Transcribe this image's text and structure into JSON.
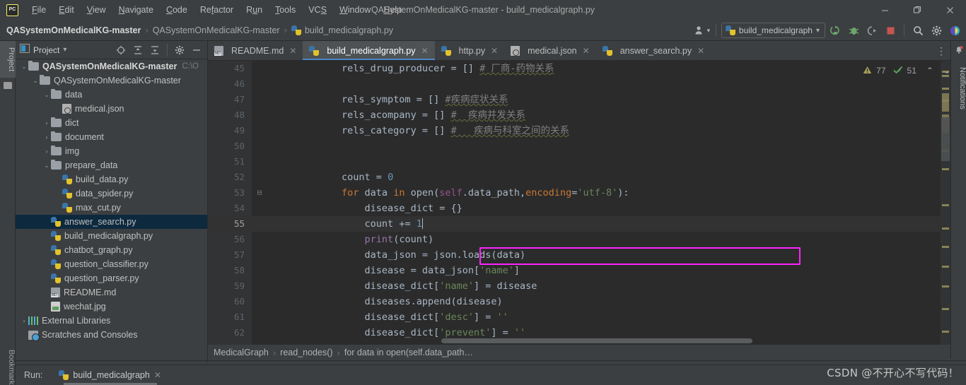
{
  "window": {
    "title": "QASystemOnMedicalKG-master - build_medicalgraph.py",
    "logo": "PC",
    "minimize": "—",
    "maximize": "❐",
    "close": "✕"
  },
  "menu": {
    "items": [
      "File",
      "Edit",
      "View",
      "Navigate",
      "Code",
      "Refactor",
      "Run",
      "Tools",
      "VCS",
      "Window",
      "Help"
    ]
  },
  "navbar": {
    "crumbs": [
      "QASystemOnMedicalKG-master",
      "QASystemOnMedicalKG-master",
      "build_medicalgraph.py"
    ],
    "separator": "›",
    "run_config": "build_medicalgraph",
    "dropdown_caret": "▾",
    "icons": {
      "user": "user-icon",
      "run": "run-icon",
      "debug": "debug-icon",
      "coverage": "coverage-icon",
      "stop": "stop-icon",
      "search": "search-icon",
      "settings": "gear-icon",
      "updates": "updates-icon"
    }
  },
  "left_strip": {
    "project_tab": "Project",
    "bookmarks_tab": "Bookmarks"
  },
  "right_strip": {
    "notifications_tab": "Notifications"
  },
  "project_panel": {
    "title": "Project",
    "caret": "▾",
    "tree": [
      {
        "indent": 0,
        "arrow": "⌄",
        "icon": "folder",
        "label": "QASystemOnMedicalKG-master",
        "bold": true,
        "path": "C:\\O",
        "selected": false
      },
      {
        "indent": 1,
        "arrow": "⌄",
        "icon": "folder",
        "label": "QASystemOnMedicalKG-master",
        "bold": false,
        "path": "",
        "selected": false
      },
      {
        "indent": 2,
        "arrow": "⌄",
        "icon": "folder",
        "label": "data",
        "bold": false,
        "path": "",
        "selected": false
      },
      {
        "indent": 3,
        "arrow": "",
        "icon": "json",
        "label": "medical.json",
        "bold": false,
        "path": "",
        "selected": false
      },
      {
        "indent": 2,
        "arrow": "›",
        "icon": "folder",
        "label": "dict",
        "bold": false,
        "path": "",
        "selected": false
      },
      {
        "indent": 2,
        "arrow": "›",
        "icon": "folder",
        "label": "document",
        "bold": false,
        "path": "",
        "selected": false
      },
      {
        "indent": 2,
        "arrow": "›",
        "icon": "folder",
        "label": "img",
        "bold": false,
        "path": "",
        "selected": false
      },
      {
        "indent": 2,
        "arrow": "⌄",
        "icon": "folder",
        "label": "prepare_data",
        "bold": false,
        "path": "",
        "selected": false
      },
      {
        "indent": 3,
        "arrow": "",
        "icon": "py",
        "label": "build_data.py",
        "bold": false,
        "path": "",
        "selected": false
      },
      {
        "indent": 3,
        "arrow": "",
        "icon": "py",
        "label": "data_spider.py",
        "bold": false,
        "path": "",
        "selected": false
      },
      {
        "indent": 3,
        "arrow": "",
        "icon": "py",
        "label": "max_cut.py",
        "bold": false,
        "path": "",
        "selected": false
      },
      {
        "indent": 2,
        "arrow": "",
        "icon": "py",
        "label": "answer_search.py",
        "bold": false,
        "path": "",
        "selected": true
      },
      {
        "indent": 2,
        "arrow": "",
        "icon": "py",
        "label": "build_medicalgraph.py",
        "bold": false,
        "path": "",
        "selected": false
      },
      {
        "indent": 2,
        "arrow": "",
        "icon": "py",
        "label": "chatbot_graph.py",
        "bold": false,
        "path": "",
        "selected": false
      },
      {
        "indent": 2,
        "arrow": "",
        "icon": "py",
        "label": "question_classifier.py",
        "bold": false,
        "path": "",
        "selected": false
      },
      {
        "indent": 2,
        "arrow": "",
        "icon": "py",
        "label": "question_parser.py",
        "bold": false,
        "path": "",
        "selected": false
      },
      {
        "indent": 2,
        "arrow": "",
        "icon": "md",
        "label": "README.md",
        "bold": false,
        "path": "",
        "selected": false
      },
      {
        "indent": 2,
        "arrow": "",
        "icon": "jpg",
        "label": "wechat.jpg",
        "bold": false,
        "path": "",
        "selected": false
      },
      {
        "indent": 0,
        "arrow": "›",
        "icon": "lib",
        "label": "External Libraries",
        "bold": false,
        "path": "",
        "selected": false
      },
      {
        "indent": 0,
        "arrow": "",
        "icon": "scratch",
        "label": "Scratches and Consoles",
        "bold": false,
        "path": "",
        "selected": false
      }
    ]
  },
  "editor_tabs": [
    {
      "label": "README.md",
      "icon": "md",
      "active": false,
      "close": "✕"
    },
    {
      "label": "build_medicalgraph.py",
      "icon": "py",
      "active": true,
      "close": "✕"
    },
    {
      "label": "http.py",
      "icon": "py",
      "active": false,
      "close": "✕"
    },
    {
      "label": "medical.json",
      "icon": "json",
      "active": false,
      "close": "✕"
    },
    {
      "label": "answer_search.py",
      "icon": "py",
      "active": false,
      "close": "✕"
    }
  ],
  "editor": {
    "warning_count": "77",
    "weakwarning_count": "51",
    "warning_icon": "warning-triangle-icon",
    "weakwarning_icon": "check-warning-icon",
    "up_arrow": "⌃",
    "down_arrow": "⌄",
    "current_line": 55,
    "lines": [
      {
        "n": 45,
        "fold": "",
        "tokens": [
          {
            "t": "        ",
            "c": "id"
          },
          {
            "t": "rels_drug_producer",
            "c": "id"
          },
          {
            "t": " = [] ",
            "c": "id"
          },
          {
            "t": "# 厂商-药物关系",
            "c": "cm"
          }
        ]
      },
      {
        "n": 46,
        "fold": "",
        "tokens": []
      },
      {
        "n": 47,
        "fold": "",
        "tokens": [
          {
            "t": "        ",
            "c": "id"
          },
          {
            "t": "rels_symptom",
            "c": "id"
          },
          {
            "t": " = [] ",
            "c": "id"
          },
          {
            "t": "#疾病症状关系",
            "c": "cm"
          }
        ]
      },
      {
        "n": 48,
        "fold": "",
        "tokens": [
          {
            "t": "        ",
            "c": "id"
          },
          {
            "t": "rels_acompany",
            "c": "id"
          },
          {
            "t": " = [] ",
            "c": "id"
          },
          {
            "t": "#  疾病并发关系",
            "c": "cm"
          }
        ]
      },
      {
        "n": 49,
        "fold": "",
        "tokens": [
          {
            "t": "        ",
            "c": "id"
          },
          {
            "t": "rels_category",
            "c": "id"
          },
          {
            "t": " = [] ",
            "c": "id"
          },
          {
            "t": "#   疾病与科室之间的关系",
            "c": "cm"
          }
        ]
      },
      {
        "n": 50,
        "fold": "",
        "tokens": []
      },
      {
        "n": 51,
        "fold": "",
        "tokens": []
      },
      {
        "n": 52,
        "fold": "",
        "tokens": [
          {
            "t": "        ",
            "c": "id"
          },
          {
            "t": "count",
            "c": "id"
          },
          {
            "t": " = ",
            "c": "id"
          },
          {
            "t": "0",
            "c": "num"
          }
        ]
      },
      {
        "n": 53,
        "fold": "⊟",
        "tokens": [
          {
            "t": "        ",
            "c": "id"
          },
          {
            "t": "for",
            "c": "kw"
          },
          {
            "t": " data ",
            "c": "id"
          },
          {
            "t": "in",
            "c": "kw"
          },
          {
            "t": " open(",
            "c": "id"
          },
          {
            "t": "self",
            "c": "self"
          },
          {
            "t": ".data_path,",
            "c": "id"
          },
          {
            "t": "encoding",
            "c": "kw"
          },
          {
            "t": "=",
            "c": "id"
          },
          {
            "t": "'utf-8'",
            "c": "str"
          },
          {
            "t": "):",
            "c": "id"
          }
        ]
      },
      {
        "n": 54,
        "fold": "",
        "tokens": [
          {
            "t": "            ",
            "c": "id"
          },
          {
            "t": "disease_dict = {}",
            "c": "id"
          }
        ]
      },
      {
        "n": 55,
        "fold": "",
        "tokens": [
          {
            "t": "            ",
            "c": "id"
          },
          {
            "t": "count += ",
            "c": "id"
          },
          {
            "t": "1",
            "c": "num"
          }
        ]
      },
      {
        "n": 56,
        "fold": "",
        "tokens": [
          {
            "t": "            ",
            "c": "id"
          },
          {
            "t": "print",
            "c": "pm"
          },
          {
            "t": "(count)",
            "c": "id"
          }
        ]
      },
      {
        "n": 57,
        "fold": "",
        "tokens": [
          {
            "t": "            ",
            "c": "id"
          },
          {
            "t": "data_json = json.loads(data)",
            "c": "id"
          }
        ]
      },
      {
        "n": 58,
        "fold": "",
        "tokens": [
          {
            "t": "            ",
            "c": "id"
          },
          {
            "t": "disease = data_json[",
            "c": "id"
          },
          {
            "t": "'name'",
            "c": "str"
          },
          {
            "t": "]",
            "c": "id"
          }
        ]
      },
      {
        "n": 59,
        "fold": "",
        "tokens": [
          {
            "t": "            ",
            "c": "id"
          },
          {
            "t": "disease_dict[",
            "c": "id"
          },
          {
            "t": "'name'",
            "c": "str"
          },
          {
            "t": "] = disease",
            "c": "id"
          }
        ]
      },
      {
        "n": 60,
        "fold": "",
        "tokens": [
          {
            "t": "            ",
            "c": "id"
          },
          {
            "t": "diseases.append(disease)",
            "c": "id"
          }
        ]
      },
      {
        "n": 61,
        "fold": "",
        "tokens": [
          {
            "t": "            ",
            "c": "id"
          },
          {
            "t": "disease_dict[",
            "c": "id"
          },
          {
            "t": "'desc'",
            "c": "str"
          },
          {
            "t": "] = ",
            "c": "id"
          },
          {
            "t": "''",
            "c": "str"
          }
        ]
      },
      {
        "n": 62,
        "fold": "",
        "tokens": [
          {
            "t": "            ",
            "c": "id"
          },
          {
            "t": "disease_dict[",
            "c": "id"
          },
          {
            "t": "'prevent'",
            "c": "str"
          },
          {
            "t": "] = ",
            "c": "id"
          },
          {
            "t": "''",
            "c": "str"
          }
        ]
      }
    ]
  },
  "editor_breadcrumb": {
    "items": [
      "MedicalGraph",
      "read_nodes()",
      "for data in open(self.data_path…"
    ],
    "separator": "›"
  },
  "run_panel": {
    "label": "Run:",
    "tab_label": "build_medicalgraph",
    "close": "✕",
    "icon": "python-icon"
  },
  "watermark": "CSDN @不开心不写代码！",
  "colors": {
    "accent_tab": "#4a88c7",
    "highlight_box": "#ff22ff",
    "selection": "#0d293e",
    "editor_bg": "#2b2b2b",
    "chrome_bg": "#3c3f41"
  }
}
